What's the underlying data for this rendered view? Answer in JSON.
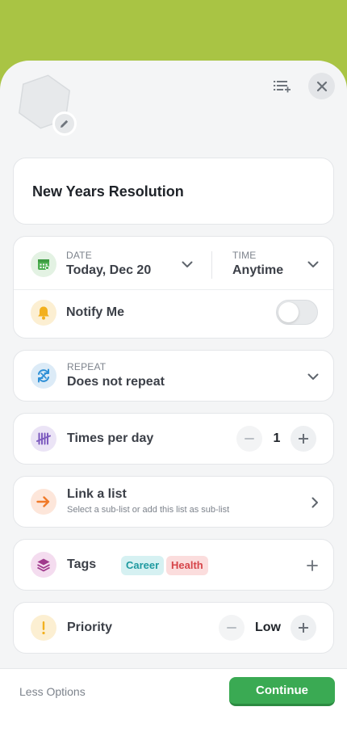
{
  "colors": {
    "header_bg": "#a9c444",
    "sheet_bg": "#f4f5f6",
    "primary_button": "#3aaa53",
    "date_icon": "#4caf50",
    "bell_icon": "#f2b01e",
    "repeat_icon": "#2d8fd6",
    "times_icon": "#7d5bbf",
    "link_icon": "#f07a2a",
    "tags_icon": "#a03a8c",
    "priority_icon": "#f2b01e"
  },
  "header": {
    "avatar_icon": "hexagon-avatar",
    "edit_icon": "pencil-icon",
    "list_icon": "list-add-icon",
    "close_icon": "close-icon"
  },
  "task": {
    "title": "New Years Resolution"
  },
  "schedule": {
    "date_label": "DATE",
    "date_value": "Today, Dec 20",
    "time_label": "TIME",
    "time_value": "Anytime",
    "notify_label": "Notify Me",
    "notify_on": false
  },
  "repeat": {
    "label": "REPEAT",
    "value": "Does not repeat"
  },
  "times_per_day": {
    "label": "Times per day",
    "value": "1"
  },
  "link_list": {
    "label": "Link a list",
    "subtitle": "Select a sub-list or add this list as sub-list"
  },
  "tags": {
    "label": "Tags",
    "items": [
      {
        "label": "Career",
        "color": "#1f9aa0",
        "bg": "#d6f1f2"
      },
      {
        "label": "Health",
        "color": "#d6454a",
        "bg": "#fbdddd"
      }
    ]
  },
  "priority": {
    "label": "Priority",
    "value": "Low"
  },
  "footer": {
    "less_options": "Less Options",
    "continue": "Continue"
  }
}
